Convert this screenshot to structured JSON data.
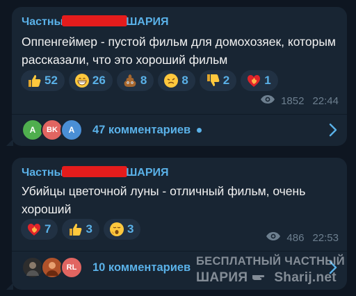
{
  "posts": [
    {
      "author": {
        "left": "Частны",
        "right": "ШАРИЯ"
      },
      "text": "Оппенгеймер - пустой фильм для домохозяек, которым рассказали, что это хороший фильм",
      "reactions": [
        {
          "icon": "thumbs-up-icon",
          "count": "52"
        },
        {
          "icon": "grinning-face-icon",
          "count": "26"
        },
        {
          "icon": "pile-of-poo-icon",
          "count": "8"
        },
        {
          "icon": "woozy-face-icon",
          "count": "8"
        },
        {
          "icon": "thumbs-down-icon",
          "count": "2"
        },
        {
          "icon": "heart-on-fire-icon",
          "count": "1"
        }
      ],
      "views": "1852",
      "time": "22:44",
      "avatars": [
        {
          "text": "A",
          "color": "#4fae4e"
        },
        {
          "text": "BK",
          "color": "#e16561"
        },
        {
          "text": "A",
          "color": "#4a8fd6"
        }
      ],
      "comments": "47 комментариев"
    },
    {
      "author": {
        "left": "Частны",
        "right": "ШАРИЯ"
      },
      "text": "Убийцы цветочной луны - отличный фильм, очень хороший",
      "reactions": [
        {
          "icon": "heart-on-fire-icon",
          "count": "7"
        },
        {
          "icon": "thumbs-up-icon",
          "count": "3"
        },
        {
          "icon": "yawning-face-icon",
          "count": "3"
        }
      ],
      "views": "486",
      "time": "22:53",
      "avatars": [
        {
          "text": "",
          "color": "#3a3a3a"
        },
        {
          "text": "",
          "color": "#b0522a"
        },
        {
          "text": "RL",
          "color": "#e16561"
        }
      ],
      "comments": "10 комментариев"
    }
  ],
  "watermark": {
    "line1": "БЕСПЛАТНЫЙ ЧАСТНЫЙ",
    "line2a": "ШАРИЯ",
    "line2b": "Sharij.net"
  }
}
